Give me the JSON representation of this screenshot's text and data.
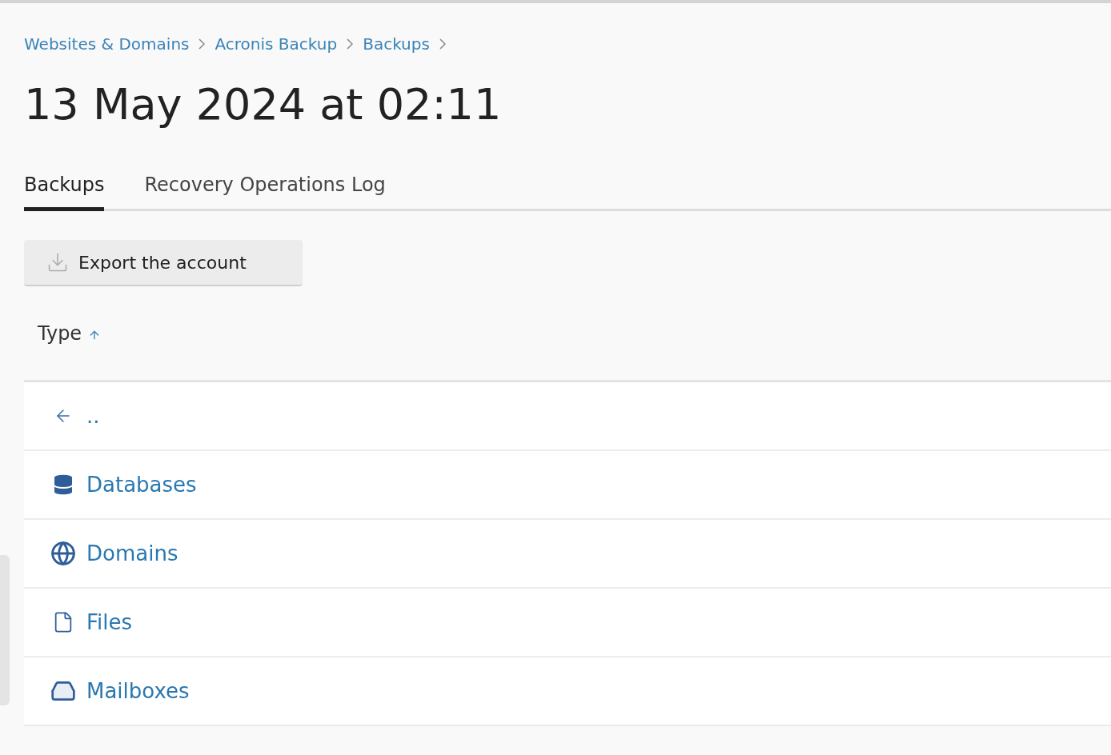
{
  "breadcrumbs": [
    "Websites & Domains",
    "Acronis Backup",
    "Backups"
  ],
  "title": "13 May 2024 at 02:11",
  "tabs": [
    {
      "label": "Backups",
      "selected": true
    },
    {
      "label": "Recovery Operations Log",
      "selected": false
    }
  ],
  "toolbar": {
    "export_button": "Export the account"
  },
  "table": {
    "columns": [
      {
        "label": "Type",
        "sort_ascending": true
      }
    ],
    "rows": [
      {
        "kind": "up",
        "label": ".."
      },
      {
        "kind": "database",
        "label": "Databases"
      },
      {
        "kind": "globe",
        "label": "Domains"
      },
      {
        "kind": "file",
        "label": "Files"
      },
      {
        "kind": "inbox",
        "label": "Mailboxes"
      }
    ]
  }
}
